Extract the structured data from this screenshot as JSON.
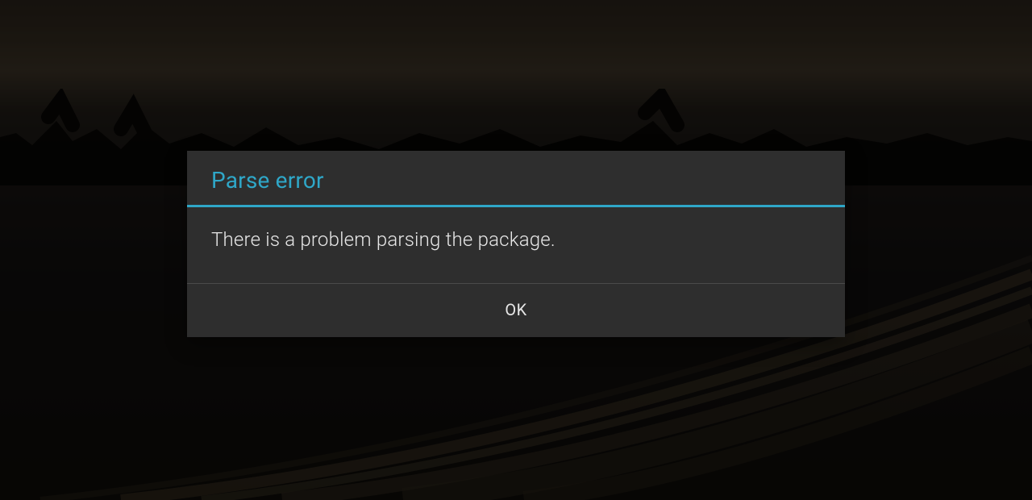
{
  "dialog": {
    "title": "Parse error",
    "message": "There is a problem parsing the package.",
    "ok_label": "OK"
  },
  "colors": {
    "accent": "#2fa7c8",
    "dialog_bg": "#2e2e2e"
  }
}
